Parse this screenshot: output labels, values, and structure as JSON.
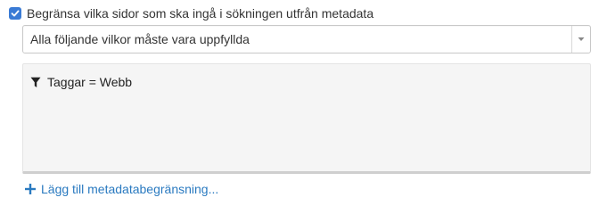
{
  "restriction": {
    "checkbox_label": "Begränsa vilka sidor som ska ingå i sökningen utfrån metadata",
    "checked": true
  },
  "condition_select": {
    "selected": "Alla följande vilkor måste vara uppfyllda"
  },
  "filters": [
    {
      "text": "Taggar = Webb",
      "icon": "filter-icon"
    }
  ],
  "add_link": {
    "label": "Lägg till metadatabegränsning...",
    "icon": "plus-icon"
  },
  "colors": {
    "accent": "#3a7bd5",
    "link": "#2a7ac0"
  }
}
